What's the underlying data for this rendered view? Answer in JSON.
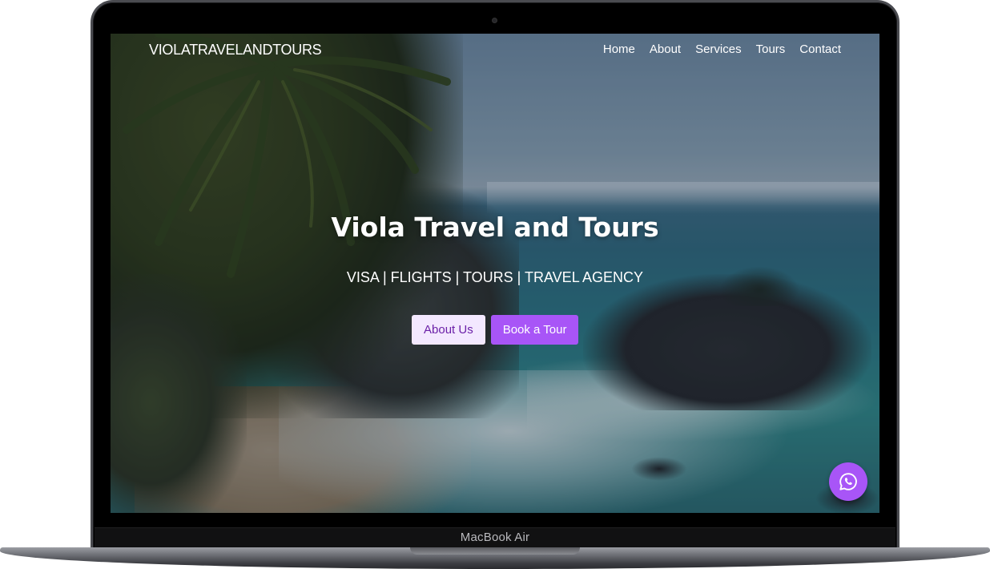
{
  "device": {
    "label": "MacBook Air"
  },
  "site": {
    "brand": "VIOLATRAVELANDTOURS",
    "nav": [
      {
        "label": "Home"
      },
      {
        "label": "About"
      },
      {
        "label": "Services"
      },
      {
        "label": "Tours"
      },
      {
        "label": "Contact"
      }
    ]
  },
  "hero": {
    "title": "Viola Travel and Tours",
    "subtitle": "VISA | FLIGHTS | TOURS | TRAVEL AGENCY",
    "buttons": {
      "about": "About Us",
      "book": "Book a Tour"
    }
  },
  "chat_widget": {
    "icon": "whatsapp-icon"
  },
  "colors": {
    "accent": "#a855f7",
    "accent_light": "#f3e8ff",
    "accent_dark_text": "#6b21a8"
  }
}
